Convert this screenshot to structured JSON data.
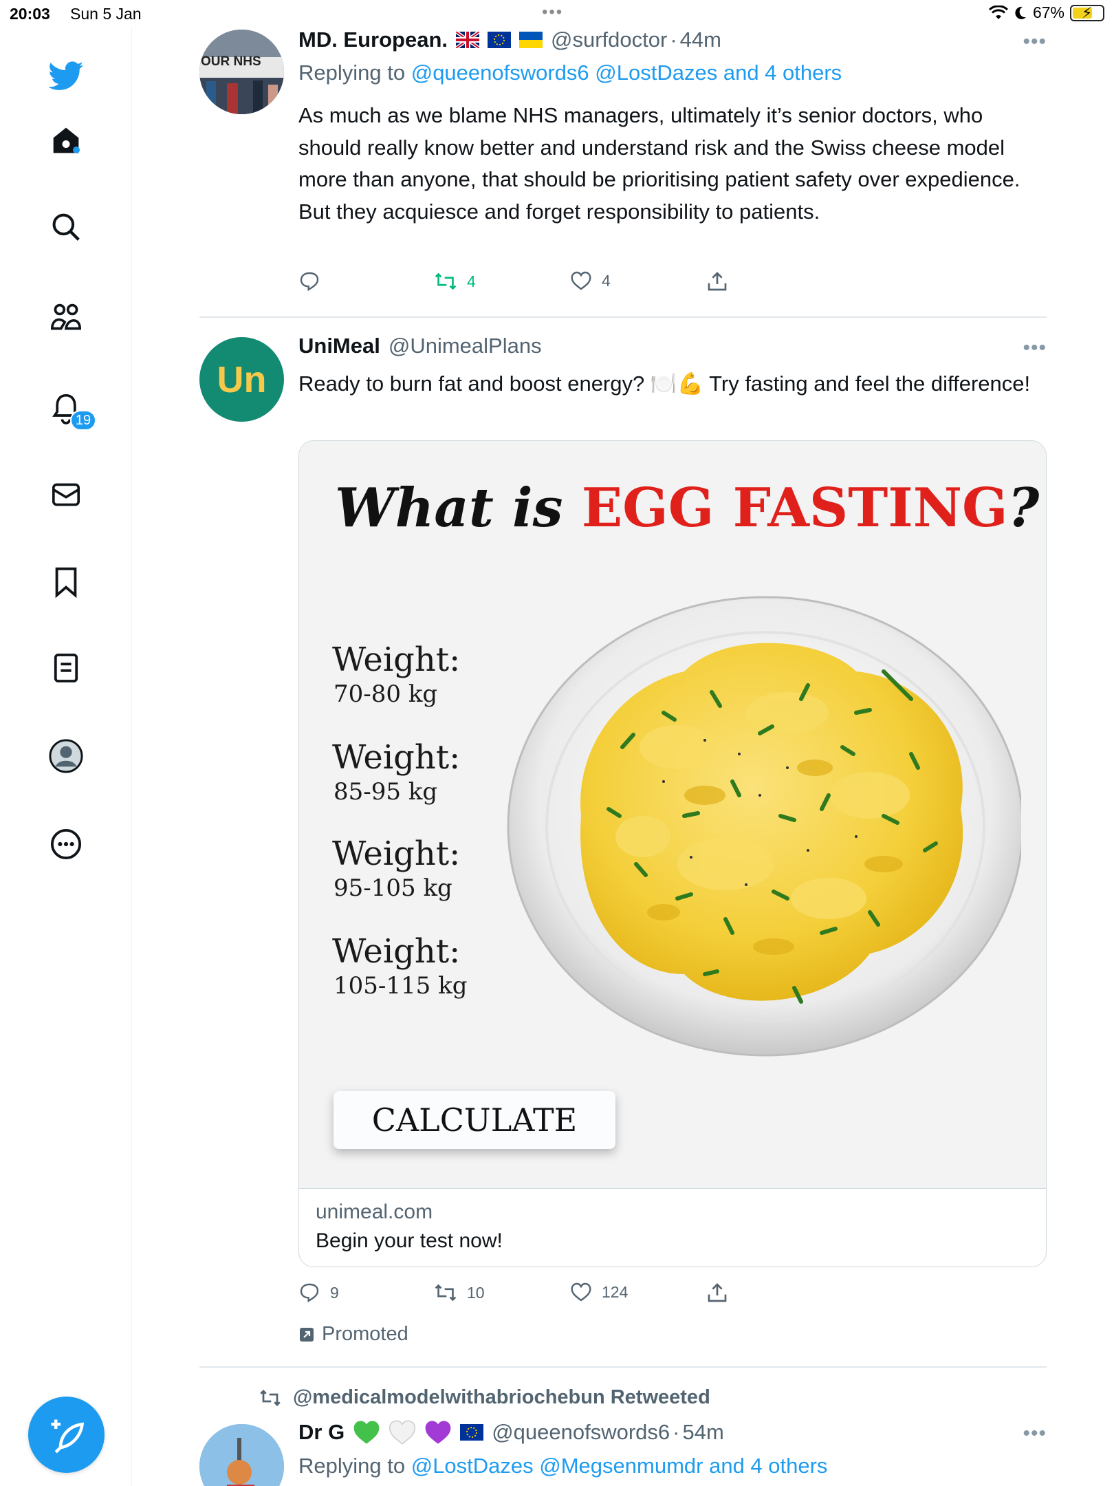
{
  "status": {
    "time": "20:03",
    "date": "Sun 5 Jan",
    "battery": "67%",
    "battery_level": 0.67
  },
  "sidebar": {
    "items": [
      {
        "name": "twitter-logo",
        "icon": "bird-icon"
      },
      {
        "name": "home",
        "icon": "home-icon"
      },
      {
        "name": "explore",
        "icon": "search-icon"
      },
      {
        "name": "communities",
        "icon": "people-icon"
      },
      {
        "name": "notifications",
        "icon": "bell-icon"
      },
      {
        "name": "messages",
        "icon": "mail-icon"
      },
      {
        "name": "bookmarks",
        "icon": "bookmark-icon"
      },
      {
        "name": "lists",
        "icon": "list-icon"
      },
      {
        "name": "profile",
        "icon": "profile-icon"
      },
      {
        "name": "more",
        "icon": "more-circle-icon"
      }
    ],
    "notification_count": "19",
    "compose_icon": "compose-icon"
  },
  "tweet1": {
    "name": "MD. European.",
    "handle": "@surfdoctor",
    "dot": "·",
    "time": "44m",
    "avatar_text": "OUR NHS",
    "reply_prefix": "Replying to",
    "reply_links": "@queenofswords6 @LostDazes and 4 others",
    "body": "As much as we blame NHS managers, ultimately it’s senior doctors, who should really know better and understand risk and the Swiss cheese model more than anyone, that should be prioritising patient safety over expedience. But they acquiesce and forget responsibility to patients.",
    "replies": "",
    "retweets": "4",
    "likes": "4"
  },
  "tweet2": {
    "name": "UniMeal",
    "handle": "@UnimealPlans",
    "avatar_text": "Un",
    "body": "Ready to burn fat and boost energy? 🍽️💪 Try fasting and feel the difference!",
    "card": {
      "title_prefix": "What is ",
      "title_highlight": "EGG FASTING",
      "title_suffix": "?",
      "weights": [
        {
          "label": "Weight:",
          "value": "70-80 kg"
        },
        {
          "label": "Weight:",
          "value": "85-95 kg"
        },
        {
          "label": "Weight:",
          "value": "95-105 kg"
        },
        {
          "label": "Weight:",
          "value": "105-115 kg"
        }
      ],
      "button": "CALCULATE",
      "domain": "unimeal.com",
      "description": "Begin your test now!"
    },
    "replies": "9",
    "retweets": "10",
    "likes": "124",
    "promoted": "Promoted"
  },
  "tweet3": {
    "retweeted_by": "@medicalmodelwithabriochebun Retweeted",
    "name": "Dr G",
    "handle": "@queenofswords6",
    "dot": "·",
    "time": "54m",
    "reply_prefix": "Replying to",
    "reply_links": "@LostDazes @Megsenmumdr and 4 others"
  },
  "colors": {
    "accent": "#1d9bf0",
    "retweet_green": "#00ba7c",
    "brand_green": "#138a72",
    "promo_red": "#e0201b"
  }
}
